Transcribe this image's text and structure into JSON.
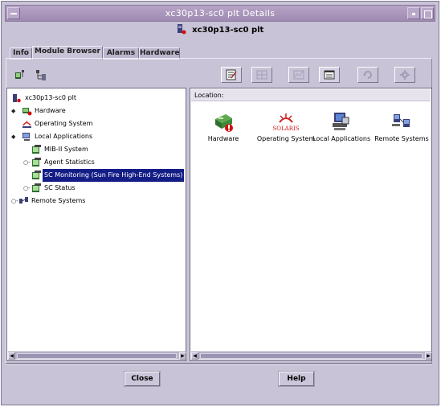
{
  "window": {
    "title": "xc30p13-sc0 plt Details",
    "host_name": "xc30p13-sc0 plt"
  },
  "tabs": [
    {
      "label": "Info",
      "active": false
    },
    {
      "label": "Module Browser",
      "active": true
    },
    {
      "label": "Alarms",
      "active": false
    },
    {
      "label": "Hardware",
      "active": false
    }
  ],
  "left_toolbar": [
    "tree-view-icon",
    "hierarchy-view-icon"
  ],
  "right_toolbar": [
    {
      "name": "edit-properties-icon",
      "enabled": true
    },
    {
      "name": "grid-icon",
      "enabled": false
    },
    {
      "name": "graph-icon",
      "enabled": false
    },
    {
      "name": "table-view-icon",
      "enabled": true
    },
    {
      "name": "refresh-icon",
      "enabled": false
    },
    {
      "name": "settings-icon",
      "enabled": false
    }
  ],
  "tree": {
    "root": "xc30p13-sc0 plt",
    "items": [
      {
        "label": "Hardware",
        "level": 1,
        "toggle": "◆"
      },
      {
        "label": "Operating System",
        "level": 1,
        "toggle": ""
      },
      {
        "label": "Local Applications",
        "level": 1,
        "toggle": "◆"
      },
      {
        "label": "MIB-II System",
        "level": 2,
        "toggle": ""
      },
      {
        "label": "Agent Statistics",
        "level": 2,
        "toggle": "○-"
      },
      {
        "label": "SC Monitoring (Sun Fire High-End Systems)",
        "level": 2,
        "toggle": "",
        "selected": true
      },
      {
        "label": "SC Status",
        "level": 2,
        "toggle": "○-"
      },
      {
        "label": "Remote Systems",
        "level": 1,
        "toggle": "○-"
      }
    ]
  },
  "location": {
    "label": "Location:"
  },
  "modules": [
    {
      "label": "Hardware"
    },
    {
      "label": "Operating System",
      "logo_text": "SOLARIS"
    },
    {
      "label": "Local Applications"
    },
    {
      "label": "Remote Systems"
    }
  ],
  "buttons": {
    "close": "Close",
    "help": "Help"
  },
  "colors": {
    "title_bar": "#a894b9",
    "window_bg": "#c8c3d6",
    "selection": "#141d86",
    "scrollbar_thumb": "#9a95b2"
  }
}
